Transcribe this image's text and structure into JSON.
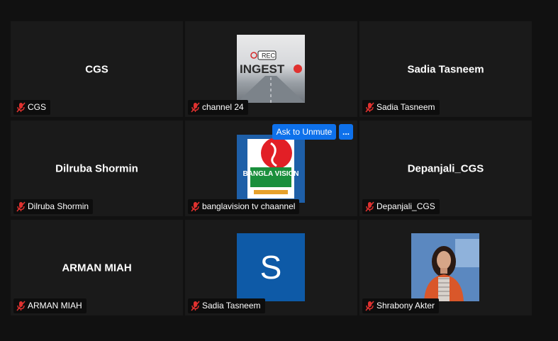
{
  "tiles": [
    {
      "display": "CGS",
      "label": "CGS"
    },
    {
      "display": "",
      "label": "channel 24",
      "avatar_text": "INGEST",
      "avatar_badge": "REC"
    },
    {
      "display": "Sadia Tasneem",
      "label": "Sadia Tasneem"
    },
    {
      "display": "Dilruba Shormin",
      "label": "Dilruba Shormin"
    },
    {
      "display": "",
      "label": "banglavision tv chaannel",
      "avatar_text": "BANGLA VISION"
    },
    {
      "display": "Depanjali_CGS",
      "label": "Depanjali_CGS"
    },
    {
      "display": "ARMAN MIAH",
      "label": "ARMAN MIAH"
    },
    {
      "display": "",
      "label": "Sadia Tasneem",
      "avatar_letter": "S"
    },
    {
      "display": "",
      "label": "Shrabony Akter"
    }
  ],
  "hover_actions": {
    "ask_to_unmute": "Ask to Unmute",
    "more": "..."
  },
  "colors": {
    "background": "#111111",
    "tile": "#1a1a1a",
    "accent": "#0e71eb",
    "muted_icon": "#e0312f"
  },
  "icons": {
    "muted": "mic-muted-icon"
  }
}
